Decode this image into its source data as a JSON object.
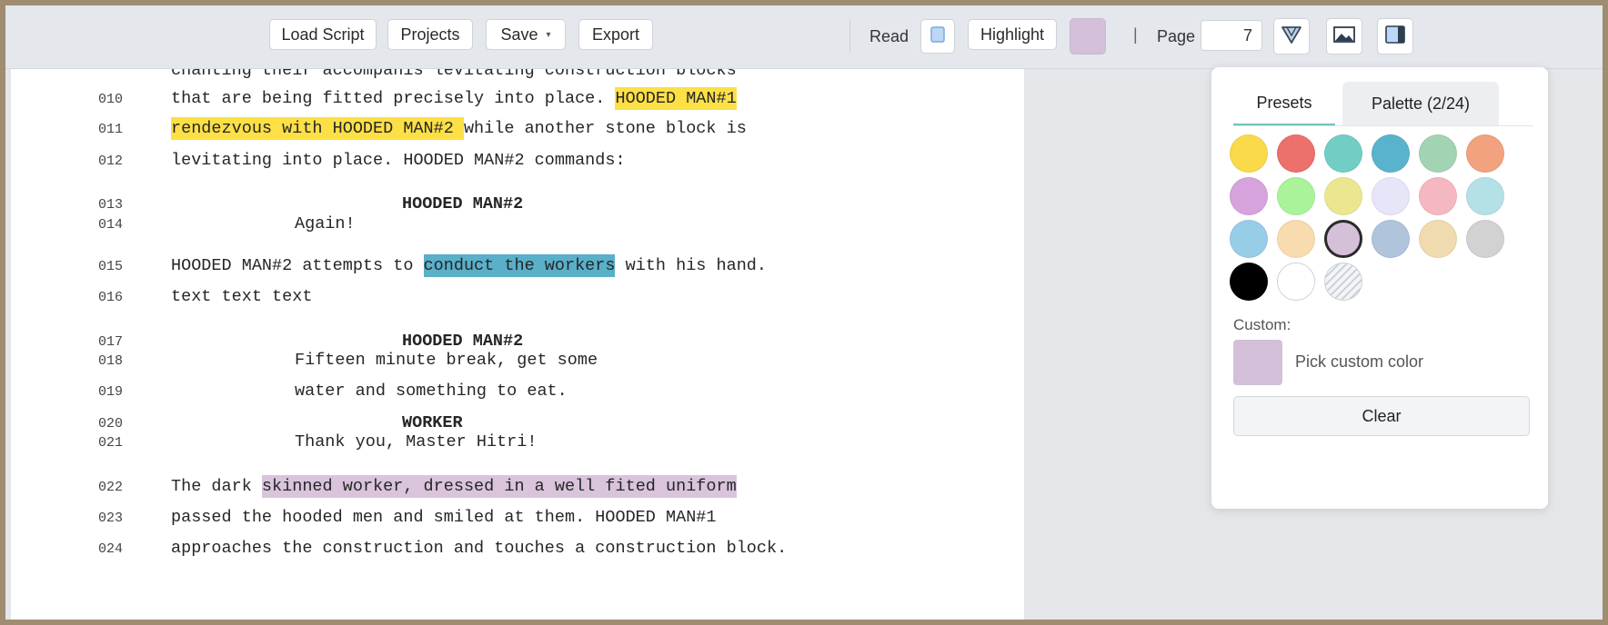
{
  "toolbar": {
    "load_script": "Load Script",
    "projects": "Projects",
    "save": "Save",
    "save_caret": "▾",
    "export": "Export",
    "read_label": "Read",
    "highlight": "Highlight",
    "divider": "|",
    "page_label": "Page",
    "page_value": "7",
    "highlight_color": "#d4c0d8",
    "icons": [
      "read-toggle-icon",
      "pen-tip-icon",
      "image-icon",
      "panel-toggle-icon"
    ]
  },
  "script": {
    "lines": [
      {
        "num": "",
        "text": "chanting their accompanis levitating construction blocks",
        "indent": "action"
      },
      {
        "num": "010",
        "segments": [
          {
            "t": "that are being fitted precisely into place. "
          },
          {
            "t": "HOODED MAN#1",
            "hl": "#fde046"
          }
        ],
        "indent": "action"
      },
      {
        "num": "011",
        "segments": [
          {
            "t": "rendezvous with HOODED MAN#2 ",
            "hl": "#fde046"
          },
          {
            "t": "while another stone block is"
          }
        ],
        "indent": "action"
      },
      {
        "num": "012",
        "text": "levitating into place. HOODED MAN#2 commands:",
        "indent": "action"
      },
      {
        "num": "013",
        "text": "HOODED MAN#2",
        "indent": "character"
      },
      {
        "num": "014",
        "text": "Again!",
        "indent": "dialogue"
      },
      {
        "num": "015",
        "segments": [
          {
            "t": "HOODED MAN#2 attempts to "
          },
          {
            "t": "conduct the workers",
            "hl": "#5aafc9"
          },
          {
            "t": " with his hand."
          }
        ],
        "indent": "action"
      },
      {
        "num": "016",
        "text": "text text text",
        "indent": "action"
      },
      {
        "num": "017",
        "text": "HOODED MAN#2",
        "indent": "character"
      },
      {
        "num": "018",
        "text": "Fifteen minute break, get some",
        "indent": "dialogue"
      },
      {
        "num": "019",
        "text": "water and something to eat.",
        "indent": "dialogue"
      },
      {
        "num": "020",
        "text": "WORKER",
        "indent": "character"
      },
      {
        "num": "021",
        "text": "Thank you, Master Hitri!",
        "indent": "dialogue"
      },
      {
        "num": "022",
        "segments": [
          {
            "t": "The dark "
          },
          {
            "t": "skinned worker, dressed in a well fited uniform",
            "hl": "#d9c4dc"
          }
        ],
        "indent": "action"
      },
      {
        "num": "023",
        "text": "passed the hooded men and smiled at them. HOODED MAN#1",
        "indent": "action"
      },
      {
        "num": "024",
        "text": "approaches the construction and touches a construction block.",
        "indent": "action"
      }
    ]
  },
  "panel": {
    "tab_presets": "Presets",
    "tab_palette": "Palette (2/24)",
    "colors": [
      "#fad94a",
      "#ec706c",
      "#72cec4",
      "#5ab3cc",
      "#a2d4b4",
      "#f2a27e",
      "#d6a3dc",
      "#aaf39a",
      "#ede690",
      "#e6e6f8",
      "#f6b8c0",
      "#b4e1e6",
      "#98cde8",
      "#f8dcaf",
      "#d4c0d8",
      "#b0c4dc",
      "#f0dbb0",
      "#d2d2d2",
      "#000000",
      "#ffffff",
      "none"
    ],
    "selected_color": "#d4c0d8",
    "custom_label": "Custom:",
    "custom_color": "#d4c0d8",
    "custom_text": "Pick custom color",
    "clear": "Clear"
  }
}
